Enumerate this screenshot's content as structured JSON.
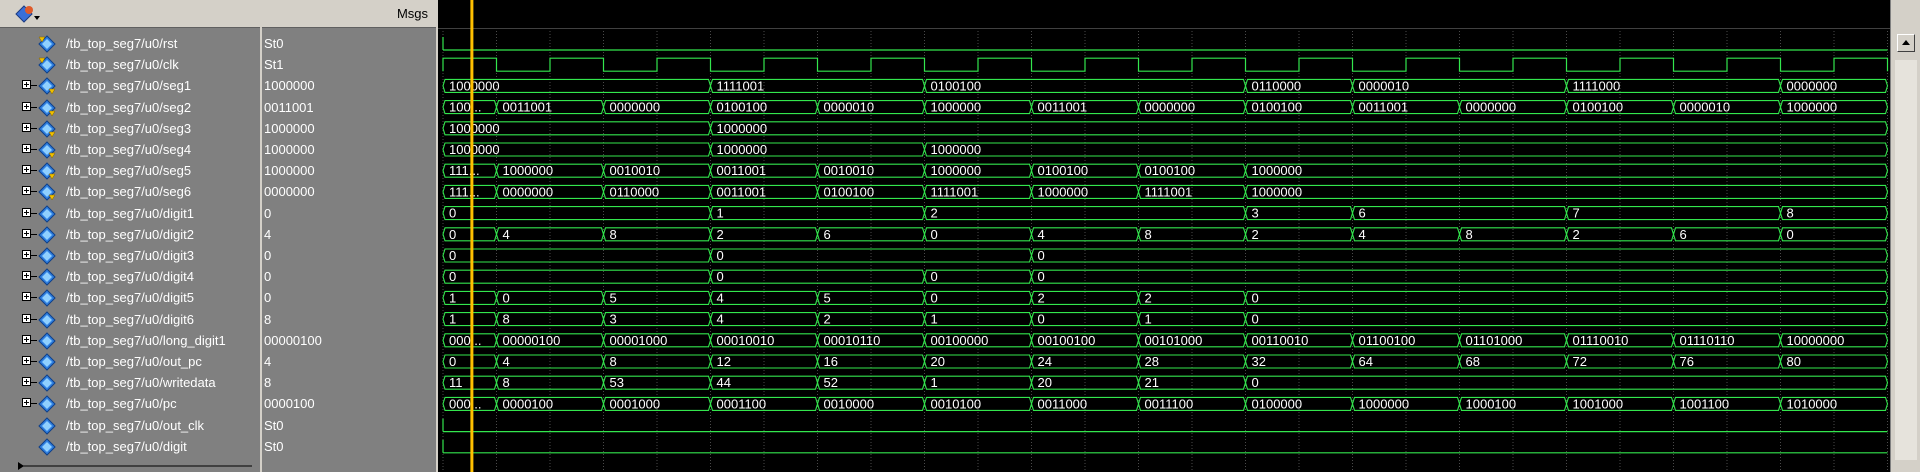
{
  "window": {
    "msgs_header": "Msgs",
    "toolbar_icon": "wave-format-icon"
  },
  "colors": {
    "wave": "#33e64d",
    "cursor": "#ffc000",
    "grid": "#4a4a4a",
    "pane_bg": "#808080",
    "wave_bg": "#000000",
    "text": "#ffffff"
  },
  "timeline": {
    "period": 1,
    "end": 13.5,
    "cursor_at": 0.27
  },
  "signals": [
    {
      "name": "/tb_top_seg7/u0/rst",
      "value": "St0",
      "kind": "bit",
      "expandable": false,
      "icon": "input-port-icon",
      "bit_segments": [
        [
          0,
          13.5,
          0
        ]
      ]
    },
    {
      "name": "/tb_top_seg7/u0/clk",
      "value": "St1",
      "kind": "clock",
      "expandable": false,
      "icon": "input-port-icon"
    },
    {
      "name": "/tb_top_seg7/u0/seg1",
      "value": "1000000",
      "kind": "bus",
      "expandable": true,
      "icon": "output-port-icon",
      "segments": [
        [
          0,
          "1000000"
        ],
        [
          2.5,
          "1111001"
        ],
        [
          4.5,
          "0100100"
        ],
        [
          7.5,
          "0110000"
        ],
        [
          8.5,
          "0000010"
        ],
        [
          10.5,
          "1111000"
        ],
        [
          12.5,
          "0000000"
        ]
      ]
    },
    {
      "name": "/tb_top_seg7/u0/seg2",
      "value": "0011001",
      "kind": "bus",
      "expandable": true,
      "icon": "output-port-icon",
      "segments": [
        [
          0,
          "100..."
        ],
        [
          0.5,
          "0011001"
        ],
        [
          1.5,
          "0000000"
        ],
        [
          2.5,
          "0100100"
        ],
        [
          3.5,
          "0000010"
        ],
        [
          4.5,
          "1000000"
        ],
        [
          5.5,
          "0011001"
        ],
        [
          6.5,
          "0000000"
        ],
        [
          7.5,
          "0100100"
        ],
        [
          8.5,
          "0011001"
        ],
        [
          9.5,
          "0000000"
        ],
        [
          10.5,
          "0100100"
        ],
        [
          11.5,
          "0000010"
        ],
        [
          12.5,
          "1000000"
        ]
      ]
    },
    {
      "name": "/tb_top_seg7/u0/seg3",
      "value": "1000000",
      "kind": "bus",
      "expandable": true,
      "icon": "output-port-icon",
      "segments": [
        [
          0,
          "1000000"
        ],
        [
          2.5,
          "1000000"
        ]
      ]
    },
    {
      "name": "/tb_top_seg7/u0/seg4",
      "value": "1000000",
      "kind": "bus",
      "expandable": true,
      "icon": "output-port-icon",
      "segments": [
        [
          0,
          "1000000"
        ],
        [
          2.5,
          "1000000"
        ],
        [
          4.5,
          "1000000"
        ]
      ]
    },
    {
      "name": "/tb_top_seg7/u0/seg5",
      "value": "1000000",
      "kind": "bus",
      "expandable": true,
      "icon": "output-port-icon",
      "segments": [
        [
          0,
          "111..."
        ],
        [
          0.5,
          "1000000"
        ],
        [
          1.5,
          "0010010"
        ],
        [
          2.5,
          "0011001"
        ],
        [
          3.5,
          "0010010"
        ],
        [
          4.5,
          "1000000"
        ],
        [
          5.5,
          "0100100"
        ],
        [
          6.5,
          "0100100"
        ],
        [
          7.5,
          "1000000"
        ]
      ]
    },
    {
      "name": "/tb_top_seg7/u0/seg6",
      "value": "0000000",
      "kind": "bus",
      "expandable": true,
      "icon": "output-port-icon",
      "segments": [
        [
          0,
          "111..."
        ],
        [
          0.5,
          "0000000"
        ],
        [
          1.5,
          "0110000"
        ],
        [
          2.5,
          "0011001"
        ],
        [
          3.5,
          "0100100"
        ],
        [
          4.5,
          "1111001"
        ],
        [
          5.5,
          "1000000"
        ],
        [
          6.5,
          "1111001"
        ],
        [
          7.5,
          "1000000"
        ]
      ]
    },
    {
      "name": "/tb_top_seg7/u0/digit1",
      "value": "0",
      "kind": "bus",
      "expandable": true,
      "icon": "signal-icon",
      "segments": [
        [
          0,
          "0"
        ],
        [
          2.5,
          "1"
        ],
        [
          4.5,
          "2"
        ],
        [
          7.5,
          "3"
        ],
        [
          8.5,
          "6"
        ],
        [
          10.5,
          "7"
        ],
        [
          12.5,
          "8"
        ]
      ]
    },
    {
      "name": "/tb_top_seg7/u0/digit2",
      "value": "4",
      "kind": "bus",
      "expandable": true,
      "icon": "signal-icon",
      "segments": [
        [
          0,
          "0"
        ],
        [
          0.5,
          "4"
        ],
        [
          1.5,
          "8"
        ],
        [
          2.5,
          "2"
        ],
        [
          3.5,
          "6"
        ],
        [
          4.5,
          "0"
        ],
        [
          5.5,
          "4"
        ],
        [
          6.5,
          "8"
        ],
        [
          7.5,
          "2"
        ],
        [
          8.5,
          "4"
        ],
        [
          9.5,
          "8"
        ],
        [
          10.5,
          "2"
        ],
        [
          11.5,
          "6"
        ],
        [
          12.5,
          "0"
        ]
      ]
    },
    {
      "name": "/tb_top_seg7/u0/digit3",
      "value": "0",
      "kind": "bus",
      "expandable": true,
      "icon": "signal-icon",
      "segments": [
        [
          0,
          "0"
        ],
        [
          2.5,
          "0"
        ],
        [
          5.5,
          "0"
        ]
      ]
    },
    {
      "name": "/tb_top_seg7/u0/digit4",
      "value": "0",
      "kind": "bus",
      "expandable": true,
      "icon": "signal-icon",
      "segments": [
        [
          0,
          "0"
        ],
        [
          2.5,
          "0"
        ],
        [
          4.5,
          "0"
        ],
        [
          5.5,
          "0"
        ]
      ]
    },
    {
      "name": "/tb_top_seg7/u0/digit5",
      "value": "0",
      "kind": "bus",
      "expandable": true,
      "icon": "signal-icon",
      "segments": [
        [
          0,
          "1"
        ],
        [
          0.5,
          "0"
        ],
        [
          1.5,
          "5"
        ],
        [
          2.5,
          "4"
        ],
        [
          3.5,
          "5"
        ],
        [
          4.5,
          "0"
        ],
        [
          5.5,
          "2"
        ],
        [
          6.5,
          "2"
        ],
        [
          7.5,
          "0"
        ]
      ]
    },
    {
      "name": "/tb_top_seg7/u0/digit6",
      "value": "8",
      "kind": "bus",
      "expandable": true,
      "icon": "signal-icon",
      "segments": [
        [
          0,
          "1"
        ],
        [
          0.5,
          "8"
        ],
        [
          1.5,
          "3"
        ],
        [
          2.5,
          "4"
        ],
        [
          3.5,
          "2"
        ],
        [
          4.5,
          "1"
        ],
        [
          5.5,
          "0"
        ],
        [
          6.5,
          "1"
        ],
        [
          7.5,
          "0"
        ]
      ]
    },
    {
      "name": "/tb_top_seg7/u0/long_digit1",
      "value": "00000100",
      "kind": "bus",
      "expandable": true,
      "icon": "signal-icon",
      "segments": [
        [
          0,
          "000..."
        ],
        [
          0.5,
          "00000100"
        ],
        [
          1.5,
          "00001000"
        ],
        [
          2.5,
          "00010010"
        ],
        [
          3.5,
          "00010110"
        ],
        [
          4.5,
          "00100000"
        ],
        [
          5.5,
          "00100100"
        ],
        [
          6.5,
          "00101000"
        ],
        [
          7.5,
          "00110010"
        ],
        [
          8.5,
          "01100100"
        ],
        [
          9.5,
          "01101000"
        ],
        [
          10.5,
          "01110010"
        ],
        [
          11.5,
          "01110110"
        ],
        [
          12.5,
          "10000000"
        ]
      ]
    },
    {
      "name": "/tb_top_seg7/u0/out_pc",
      "value": "4",
      "kind": "bus",
      "expandable": true,
      "icon": "signal-icon",
      "segments": [
        [
          0,
          "0"
        ],
        [
          0.5,
          "4"
        ],
        [
          1.5,
          "8"
        ],
        [
          2.5,
          "12"
        ],
        [
          3.5,
          "16"
        ],
        [
          4.5,
          "20"
        ],
        [
          5.5,
          "24"
        ],
        [
          6.5,
          "28"
        ],
        [
          7.5,
          "32"
        ],
        [
          8.5,
          "64"
        ],
        [
          9.5,
          "68"
        ],
        [
          10.5,
          "72"
        ],
        [
          11.5,
          "76"
        ],
        [
          12.5,
          "80"
        ]
      ]
    },
    {
      "name": "/tb_top_seg7/u0/writedata",
      "value": "8",
      "kind": "bus",
      "expandable": true,
      "icon": "signal-icon",
      "segments": [
        [
          0,
          "11"
        ],
        [
          0.5,
          "8"
        ],
        [
          1.5,
          "53"
        ],
        [
          2.5,
          "44"
        ],
        [
          3.5,
          "52"
        ],
        [
          4.5,
          "1"
        ],
        [
          5.5,
          "20"
        ],
        [
          6.5,
          "21"
        ],
        [
          7.5,
          "0"
        ]
      ]
    },
    {
      "name": "/tb_top_seg7/u0/pc",
      "value": "0000100",
      "kind": "bus",
      "expandable": true,
      "icon": "signal-icon",
      "segments": [
        [
          0,
          "000..."
        ],
        [
          0.5,
          "0000100"
        ],
        [
          1.5,
          "0001000"
        ],
        [
          2.5,
          "0001100"
        ],
        [
          3.5,
          "0010000"
        ],
        [
          4.5,
          "0010100"
        ],
        [
          5.5,
          "0011000"
        ],
        [
          6.5,
          "0011100"
        ],
        [
          7.5,
          "0100000"
        ],
        [
          8.5,
          "1000000"
        ],
        [
          9.5,
          "1000100"
        ],
        [
          10.5,
          "1001000"
        ],
        [
          11.5,
          "1001100"
        ],
        [
          12.5,
          "1010000"
        ]
      ]
    },
    {
      "name": "/tb_top_seg7/u0/out_clk",
      "value": "St0",
      "kind": "bit",
      "expandable": false,
      "icon": "signal-icon",
      "bit_segments": [
        [
          0,
          13.5,
          0
        ]
      ]
    },
    {
      "name": "/tb_top_seg7/u0/digit",
      "value": "St0",
      "kind": "bit",
      "expandable": false,
      "icon": "signal-icon",
      "bit_segments": [
        [
          0,
          13.5,
          0
        ]
      ]
    }
  ]
}
